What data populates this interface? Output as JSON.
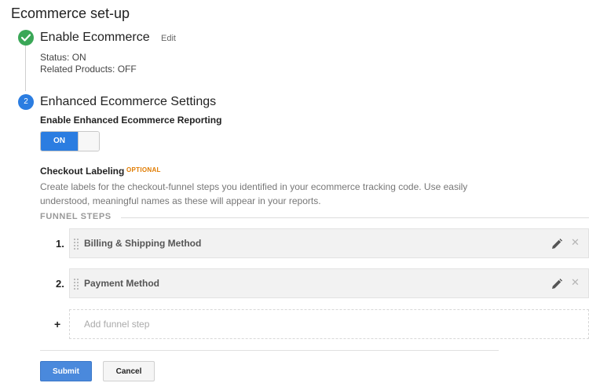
{
  "page": {
    "title": "Ecommerce set-up"
  },
  "step1": {
    "title": "Enable Ecommerce",
    "edit_label": "Edit",
    "status": "Status: ON",
    "related": "Related Products: OFF",
    "icon": "check-circle-icon"
  },
  "step2": {
    "number": "2",
    "title": "Enhanced Ecommerce Settings",
    "reporting_label": "Enable Enhanced Ecommerce Reporting",
    "toggle_label": "ON",
    "toggle_state": "on"
  },
  "checkout": {
    "label": "Checkout Labeling",
    "optional": "OPTIONAL",
    "description": "Create labels for the checkout-funnel steps you identified in your ecommerce tracking code. Use easily understood, meaningful names as these will appear in your reports."
  },
  "funnel": {
    "header": "FUNNEL STEPS",
    "steps": [
      {
        "number": "1.",
        "label": "Billing & Shipping Method"
      },
      {
        "number": "2.",
        "label": "Payment Method"
      }
    ],
    "add_plus": "+",
    "add_label": "Add funnel step"
  },
  "actions": {
    "submit": "Submit",
    "cancel": "Cancel"
  },
  "colors": {
    "accent": "#2b7de1",
    "success": "#3aa757",
    "optional": "#e07b00",
    "submit": "#4a89dc"
  }
}
